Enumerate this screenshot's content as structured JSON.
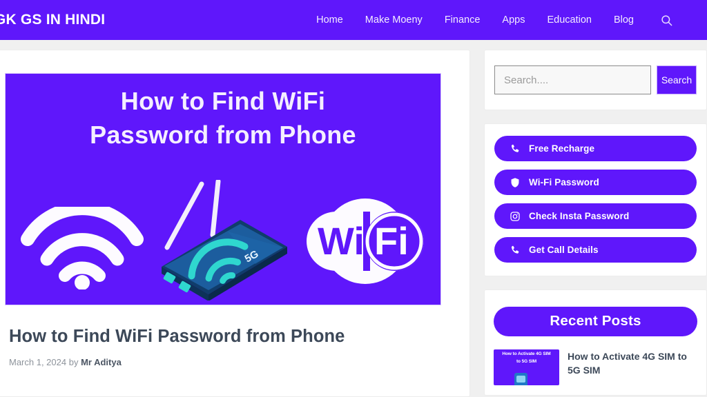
{
  "header": {
    "brand": "GK GS IN HINDI",
    "nav": [
      {
        "label": "Home"
      },
      {
        "label": "Make Moeny"
      },
      {
        "label": "Finance"
      },
      {
        "label": "Apps"
      },
      {
        "label": "Education"
      },
      {
        "label": "Blog"
      }
    ],
    "search_icon": "search-icon",
    "background_color": "#5f17fb"
  },
  "article": {
    "hero": {
      "title_line1": "How to Find WiFi",
      "title_line2": "Password from Phone",
      "background_color": "#5f17fb",
      "art": {
        "wifi_icon": "wifi-signal-icon",
        "router_label": "5G",
        "badge_text_left": "Wi",
        "badge_text_right": "Fi"
      }
    },
    "title": "How to Find WiFi Password from Phone",
    "meta_date": "March 1, 2024 by",
    "meta_author": "Mr Aditya"
  },
  "sidebar": {
    "search": {
      "placeholder": "Search....",
      "value": "",
      "button_label": "Search"
    },
    "links": [
      {
        "label": "Free Recharge",
        "icon": "phone-icon"
      },
      {
        "label": "Wi-Fi Password",
        "icon": "shield-icon"
      },
      {
        "label": "Check Insta Password",
        "icon": "instagram-icon"
      },
      {
        "label": "Get Call Details",
        "icon": "phone-icon"
      }
    ],
    "recent": {
      "heading": "Recent Posts",
      "posts": [
        {
          "title": "How to Activate 4G SIM to 5G SIM",
          "thumb_line1": "How to Activate 4G SIM",
          "thumb_line2": "to 5G SIM"
        }
      ]
    }
  }
}
